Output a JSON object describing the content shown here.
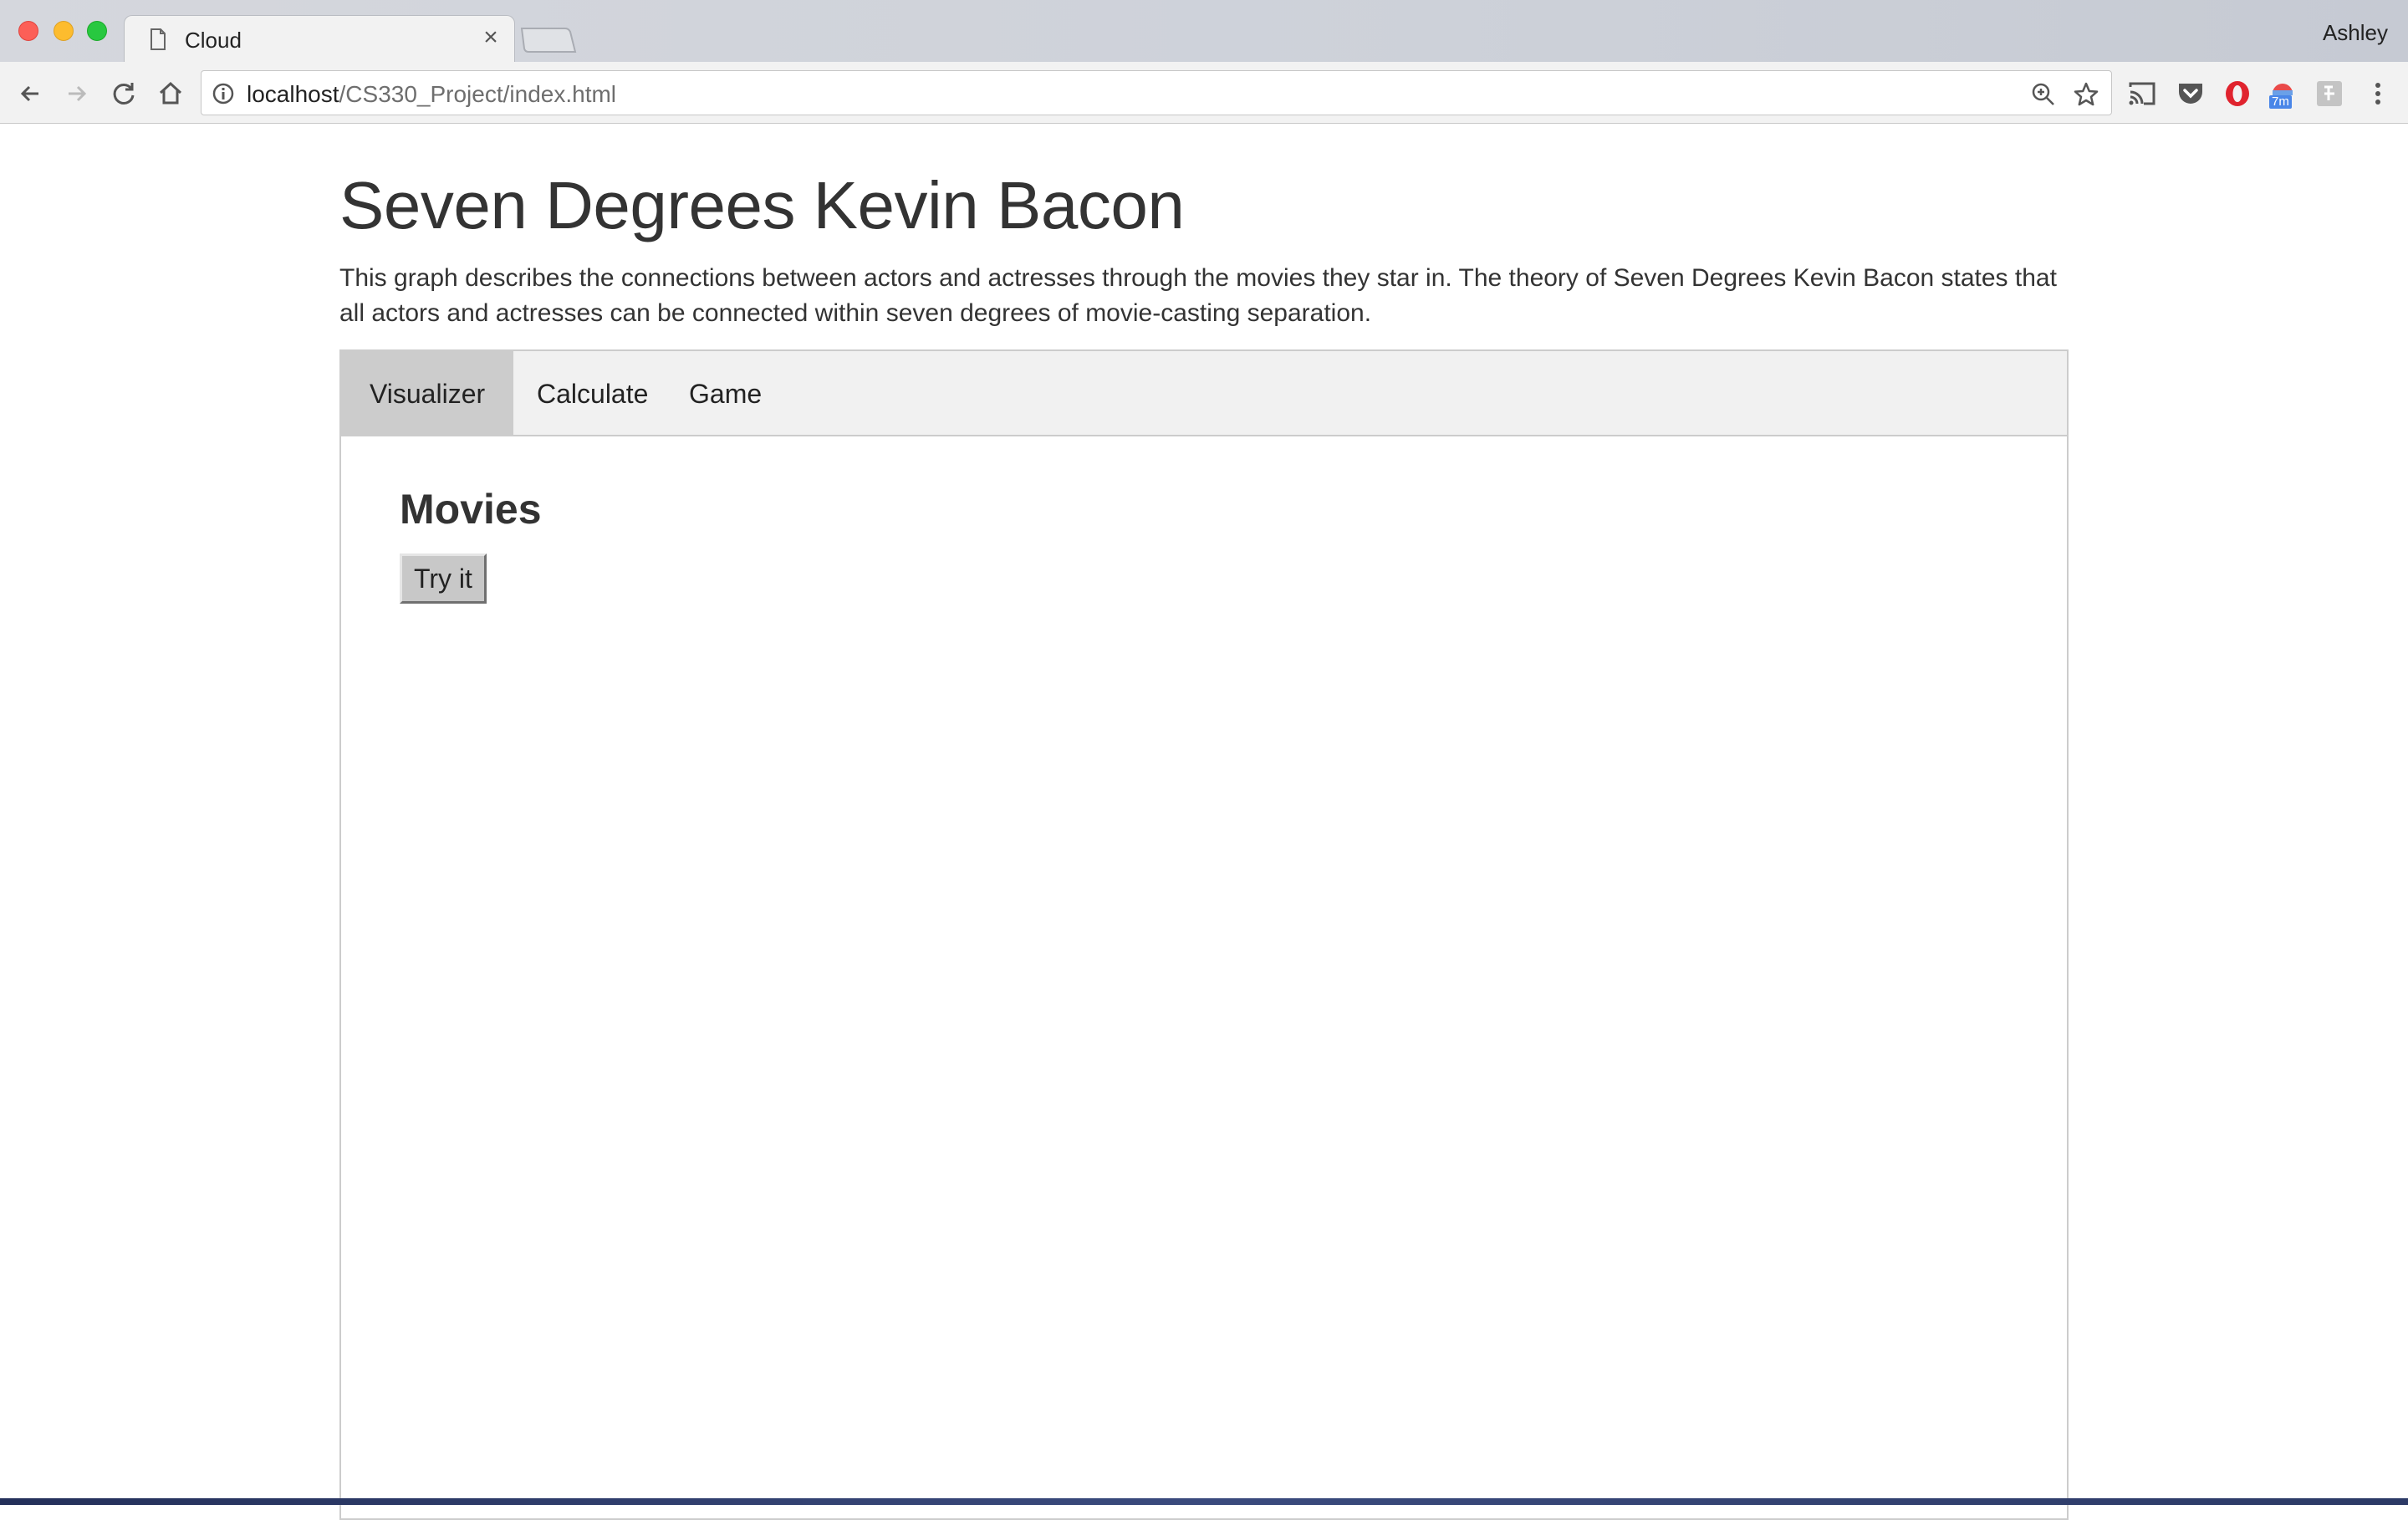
{
  "browser": {
    "tab_title": "Cloud",
    "tab_close_glyph": "×",
    "profile_name": "Ashley",
    "url_host": "localhost",
    "url_path": "/CS330_Project/index.html",
    "extension_badge": "7m",
    "icons": [
      "back-icon",
      "forward-icon",
      "reload-icon",
      "home-icon",
      "info-icon",
      "zoom-icon",
      "star-icon",
      "cast-icon",
      "pocket-icon",
      "opera-icon",
      "timer-extension-icon",
      "extension-icon",
      "menu-icon"
    ]
  },
  "page": {
    "title": "Seven Degrees Kevin Bacon",
    "description": "This graph describes the connections between actors and actresses through the movies they star in. The theory of Seven Degrees Kevin Bacon states that all actors and actresses can be connected within seven degrees of movie-casting separation.",
    "tabs": [
      {
        "label": "Visualizer",
        "active": true
      },
      {
        "label": "Calculate",
        "active": false
      },
      {
        "label": "Game",
        "active": false
      }
    ],
    "content": {
      "heading": "Movies",
      "button_label": "Try it"
    }
  },
  "colors": {
    "text": "#333333",
    "tabbar_bg": "#f1f1f1",
    "active_tab_bg": "#cccccc",
    "border": "#cccccc"
  }
}
